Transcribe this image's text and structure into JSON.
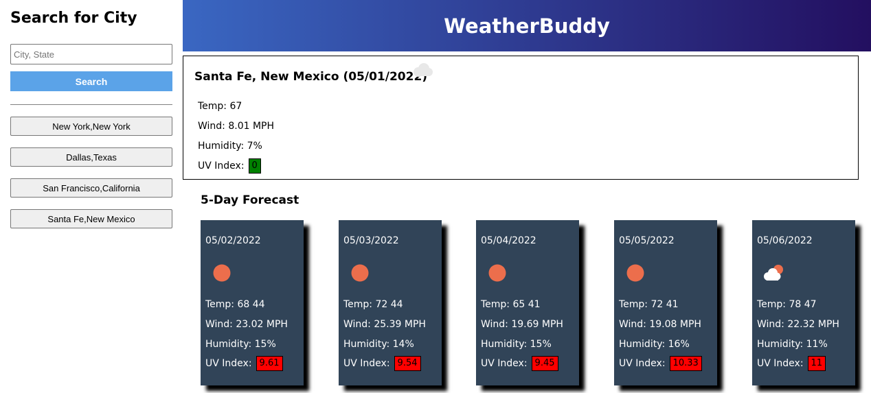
{
  "sidebar": {
    "title": "Search for City",
    "search_placeholder": "City, State",
    "search_label": "Search",
    "history": [
      "New York,New York",
      "Dallas,Texas",
      "San Francisco,California",
      "Santa Fe,New Mexico"
    ]
  },
  "header": {
    "title": "WeatherBuddy"
  },
  "current": {
    "title": "Santa Fe, New Mexico (05/01/2022)",
    "icon": "cloud-icon",
    "temp": "Temp: 67",
    "wind": "Wind: 8.01 MPH",
    "humidity": "Humidity: 7%",
    "uv_label": "UV Index:",
    "uv_value": "0",
    "uv_color": "#008000"
  },
  "forecast": {
    "title": "5-Day Forecast",
    "uv_label": "UV Index:",
    "uv_color": "#ff0000",
    "days": [
      {
        "date": "05/02/2022",
        "icon": "sun-icon",
        "temp": "Temp: 68 44",
        "wind": "Wind: 23.02 MPH",
        "humidity": "Humidity: 15%",
        "uv": "9.61"
      },
      {
        "date": "05/03/2022",
        "icon": "sun-icon",
        "temp": "Temp: 72 44",
        "wind": "Wind: 25.39 MPH",
        "humidity": "Humidity: 14%",
        "uv": "9.54"
      },
      {
        "date": "05/04/2022",
        "icon": "sun-icon",
        "temp": "Temp: 65 41",
        "wind": "Wind: 19.69 MPH",
        "humidity": "Humidity: 15%",
        "uv": "9.45"
      },
      {
        "date": "05/05/2022",
        "icon": "sun-icon",
        "temp": "Temp: 72 41",
        "wind": "Wind: 19.08 MPH",
        "humidity": "Humidity: 16%",
        "uv": "10.33"
      },
      {
        "date": "05/06/2022",
        "icon": "partly-cloudy-icon",
        "temp": "Temp: 78 47",
        "wind": "Wind: 22.32 MPH",
        "humidity": "Humidity: 11%",
        "uv": "11"
      }
    ]
  }
}
